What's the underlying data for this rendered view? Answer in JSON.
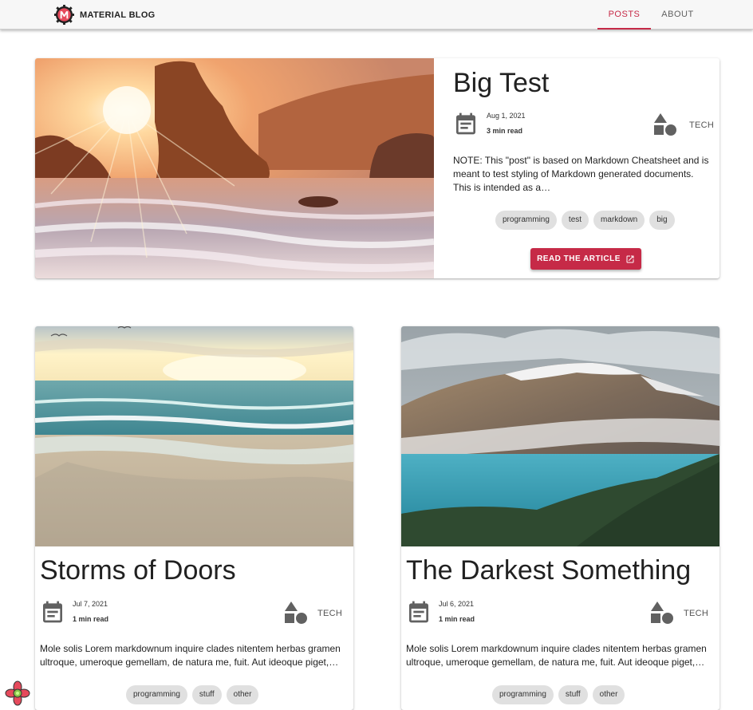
{
  "header": {
    "brand": "MATERIAL BLOG",
    "tabs": [
      {
        "label": "POSTS",
        "active": true
      },
      {
        "label": "ABOUT",
        "active": false
      }
    ]
  },
  "colors": {
    "accent": "#c62a47",
    "chip": "#e0e0e0"
  },
  "featured": {
    "title": "Big Test",
    "date": "Aug 1, 2021",
    "read_time": "3 min read",
    "category": "TECH",
    "excerpt": "NOTE: This \"post\" is based on Markdown Cheatsheet and is meant to test styling of Markdown generated documents. This is intended as a…",
    "tags": [
      "programming",
      "test",
      "markdown",
      "big"
    ],
    "button": "READ THE ARTICLE",
    "image": "sunset-beach-rocks"
  },
  "posts": [
    {
      "title": "Storms of Doors",
      "date": "Jul 7, 2021",
      "read_time": "1 min read",
      "category": "TECH",
      "excerpt": "Mole solis Lorem markdownum inquire clades nitentem herbas gramen ultroque, umeroque gemellam, de natura me, fuit. Aut ideoque piget,…",
      "tags": [
        "programming",
        "stuff",
        "other"
      ],
      "image": "ocean-waves-sunrise"
    },
    {
      "title": "The Darkest Something",
      "date": "Jul 6, 2021",
      "read_time": "1 min read",
      "category": "TECH",
      "excerpt": "Mole solis Lorem markdownum inquire clades nitentem herbas gramen ultroque, umeroque gemellam, de natura me, fuit. Aut ideoque piget,…",
      "tags": [
        "programming",
        "stuff",
        "other"
      ],
      "image": "mountain-lake"
    }
  ],
  "icons": {
    "calendar": "calendar-icon",
    "category": "shapes-icon",
    "external": "open-in-new-icon",
    "logo": "material-m-logo"
  }
}
